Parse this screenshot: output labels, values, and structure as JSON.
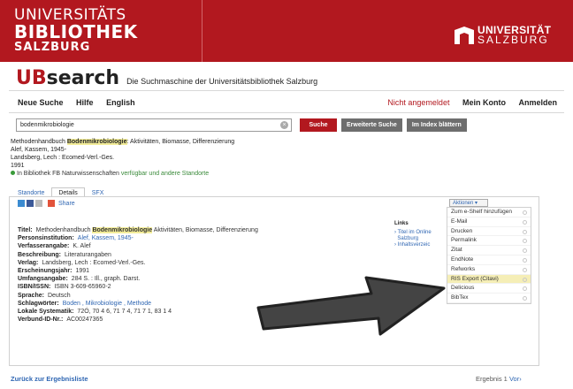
{
  "header": {
    "library_logo_line1": "UNIVERSITÄTS",
    "library_logo_line2": "BIBLIOTHEK",
    "library_logo_line3": "SALZBURG",
    "university_logo_line1": "UNIVERSITÄT",
    "university_logo_line2": "SALZBURG",
    "brand_accent": "#b2181f"
  },
  "brand": {
    "ub": "UB",
    "search": "search",
    "tagline": "Die Suchmaschine der Universitätsbibliothek Salzburg"
  },
  "nav": {
    "new_search": "Neue Suche",
    "help": "Hilfe",
    "english": "English",
    "status": "Nicht angemeldet",
    "account": "Mein Konto",
    "login": "Anmelden"
  },
  "search": {
    "query": "bodenmikrobiologie",
    "submit": "Suche",
    "advanced": "Erweiterte Suche",
    "browse_index": "Im Index blättern"
  },
  "record": {
    "title_prefix": "Methodenhandbuch",
    "title_highlight": "Bodenmikrobiologie",
    "title_suffix": ": Aktivitäten, Biomasse, Differenzierung",
    "authors": "Alef, Kassem, 1945-",
    "publisher": "Landsberg, Lech : Ecomed-Verl.-Ges.",
    "year": "1991",
    "availability_prefix": "In Bibliothek FB Naturwissenschaften",
    "availability_link": "verfügbar und andere Standorte"
  },
  "tabs": [
    "Standorte",
    "Details",
    "SFX"
  ],
  "share": {
    "label": "Share"
  },
  "details": {
    "title_label": "Titel:",
    "title_value_prefix": "Methodenhandbuch",
    "title_value_highlight": "Bodenmikrobiologie",
    "title_value_suffix": "Aktivitäten, Biomasse, Differenzierung",
    "person_label": "Personsinstitution:",
    "person_value": "Alef, Kassem, 1945-",
    "responsibility_label": "Verfasserangabe:",
    "responsibility_value": "K. Alef",
    "description_label": "Beschreibung:",
    "description_value": "Literaturangaben",
    "publisher_label": "Verlag:",
    "publisher_value": "Landsberg, Lech : Ecomed-Verl.-Ges.",
    "pubyear_label": "Erscheinungsjahr:",
    "pubyear_value": "1991",
    "extent_label": "Umfangsangabe:",
    "extent_value": "284 S. : Ill., graph. Darst.",
    "isbn_label": "ISBN/ISSN:",
    "isbn_value": "ISBN 3-609-65960-2",
    "language_label": "Sprache:",
    "language_value": "Deutsch",
    "keywords_label": "Schlagwörter:",
    "keywords_value": "Boden , Mikrobiologie , Methode",
    "classification_label": "Lokale Systematik:",
    "classification_value": "72Ó, 70 4 6, 71 7 4, 71 7 1, 83 1 4",
    "union_id_label": "Verbund-ID-Nr.:",
    "union_id_value": "AC00247365"
  },
  "links_box": {
    "heading": "Links",
    "item1": "Titel im Online",
    "item1b": "Salzburg",
    "item2": "Inhaltsverzeic"
  },
  "actions": {
    "button": "Aktionen",
    "items": [
      "Zum e-Shelf hinzufügen",
      "E-Mail",
      "Drucken",
      "Permalink",
      "Zitat",
      "EndNote",
      "Refworks",
      "RIS Export (Citavi)",
      "Delicious",
      "BibTex"
    ],
    "selected_index": 7
  },
  "footer": {
    "back": "Zurück zur Ergebnisliste",
    "result": "Ergebnis 1",
    "next": "Vor"
  }
}
